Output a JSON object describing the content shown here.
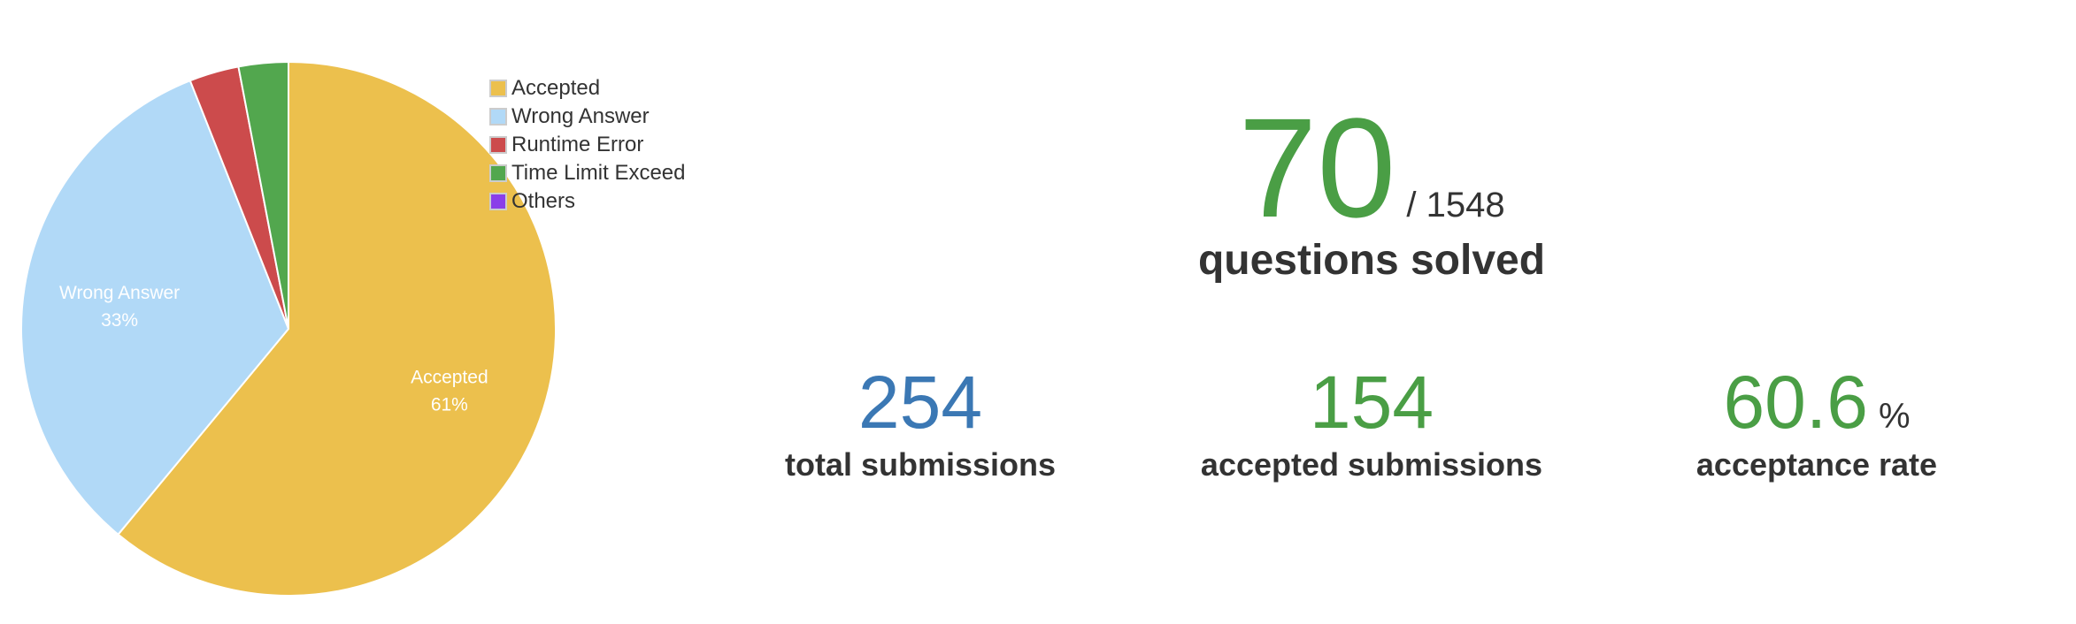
{
  "chart_data": {
    "type": "pie",
    "slices": [
      {
        "label": "Accepted",
        "value": 61,
        "color": "#ecc04d",
        "data_label": "Accepted",
        "data_pct": "61%"
      },
      {
        "label": "Wrong Answer",
        "value": 33,
        "color": "#b1d9f7",
        "data_label": "Wrong Answer",
        "data_pct": "33%"
      },
      {
        "label": "Runtime Error",
        "value": 3,
        "color": "#cc4b4c",
        "data_label": "",
        "data_pct": ""
      },
      {
        "label": "Time Limit Exceed",
        "value": 3,
        "color": "#52a74e",
        "data_label": "",
        "data_pct": ""
      },
      {
        "label": "Others",
        "value": 0,
        "color": "#8a3fe9",
        "data_label": "",
        "data_pct": ""
      }
    ],
    "legend_position": "top-right"
  },
  "solved": {
    "count": "70",
    "total": "/ 1548",
    "label": "questions solved",
    "color": "#4a9e45"
  },
  "stats": [
    {
      "value": "254",
      "suffix": "",
      "label": "total submissions",
      "color": "#3b78b4"
    },
    {
      "value": "154",
      "suffix": "",
      "label": "accepted submissions",
      "color": "#4a9e45"
    },
    {
      "value": "60.6",
      "suffix": "%",
      "label": "acceptance rate",
      "color": "#4a9e45"
    }
  ]
}
